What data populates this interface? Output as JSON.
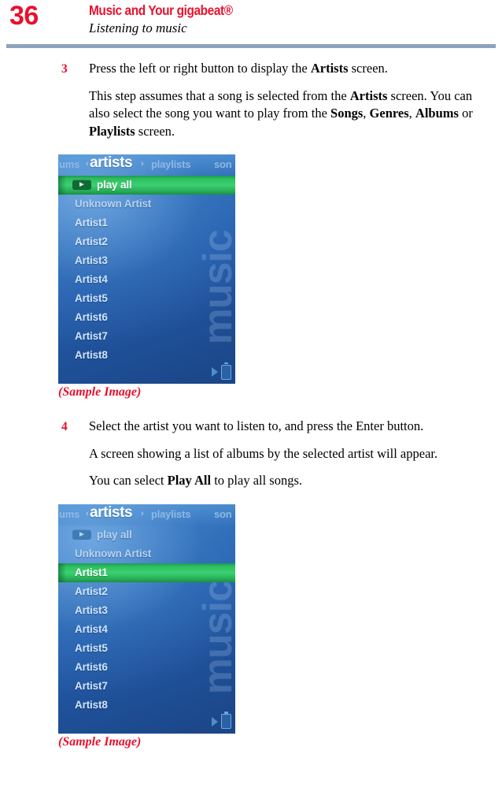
{
  "header": {
    "page_number": "36",
    "book_title": "Music and Your gigabeat®",
    "section_title": "Listening to music"
  },
  "steps": [
    {
      "number": "3",
      "paragraphs": [
        "Press the left or right button to display the Artists screen.",
        "This step assumes that a song is selected from the Artists screen. You can also select the song you want to play from the Songs, Genres, Albums or Playlists screen."
      ]
    },
    {
      "number": "4",
      "paragraphs": [
        "Select the artist you want to listen to, and press the Enter button.",
        "A screen showing a list of albums by the selected artist will appear.",
        "You can select Play All to play all songs."
      ]
    }
  ],
  "figures": [
    {
      "caption": "(Sample Image)",
      "watermark": "music",
      "tabs": {
        "albums_partial": "ums",
        "active": "artists",
        "playlists": "playlists",
        "songs_partial": "son",
        "arrow_left": "‹",
        "arrow_right": "›"
      },
      "rows": [
        {
          "label": "play all",
          "selected": true,
          "has_button": true
        },
        {
          "label": "Unknown Artist",
          "selected": false,
          "has_button": false
        },
        {
          "label": "Artist1",
          "selected": false,
          "has_button": false
        },
        {
          "label": "Artist2",
          "selected": false,
          "has_button": false
        },
        {
          "label": "Artist3",
          "selected": false,
          "has_button": false
        },
        {
          "label": "Artist4",
          "selected": false,
          "has_button": false
        },
        {
          "label": "Artist5",
          "selected": false,
          "has_button": false
        },
        {
          "label": "Artist6",
          "selected": false,
          "has_button": false
        },
        {
          "label": "Artist7",
          "selected": false,
          "has_button": false
        },
        {
          "label": "Artist8",
          "selected": false,
          "has_button": false
        }
      ]
    },
    {
      "caption": "(Sample Image)",
      "watermark": "music",
      "tabs": {
        "albums_partial": "ums",
        "active": "artists",
        "playlists": "playlists",
        "songs_partial": "son",
        "arrow_left": "‹",
        "arrow_right": "›"
      },
      "rows": [
        {
          "label": "play all",
          "selected": false,
          "has_button": true
        },
        {
          "label": "Unknown Artist",
          "selected": false,
          "has_button": false
        },
        {
          "label": "Artist1",
          "selected": true,
          "has_button": false
        },
        {
          "label": "Artist2",
          "selected": false,
          "has_button": false
        },
        {
          "label": "Artist3",
          "selected": false,
          "has_button": false
        },
        {
          "label": "Artist4",
          "selected": false,
          "has_button": false
        },
        {
          "label": "Artist5",
          "selected": false,
          "has_button": false
        },
        {
          "label": "Artist6",
          "selected": false,
          "has_button": false
        },
        {
          "label": "Artist7",
          "selected": false,
          "has_button": false
        },
        {
          "label": "Artist8",
          "selected": false,
          "has_button": false
        }
      ]
    }
  ],
  "colors": {
    "accent_red": "#e8112d",
    "rule_blue": "#8ba3bc",
    "selection_green": "#3cd072",
    "screen_blue": "#255fae"
  }
}
